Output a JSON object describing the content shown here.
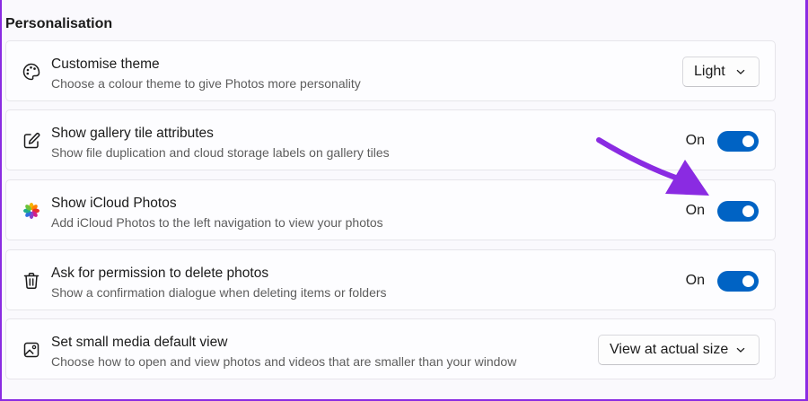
{
  "section": {
    "title": "Personalisation"
  },
  "settings": [
    {
      "title": "Customise theme",
      "desc": "Choose a colour theme to give Photos more personality",
      "icon": "palette-icon",
      "control": "dropdown",
      "value": "Light"
    },
    {
      "title": "Show gallery tile attributes",
      "desc": "Show file duplication and cloud storage labels on gallery tiles",
      "icon": "edit-square-icon",
      "control": "toggle",
      "state_label": "On",
      "on": true
    },
    {
      "title": "Show iCloud Photos",
      "desc": "Add iCloud Photos to the left navigation to view your photos",
      "icon": "icloud-photos-flower-icon",
      "control": "toggle",
      "state_label": "On",
      "on": true
    },
    {
      "title": "Ask for permission to delete photos",
      "desc": "Show a confirmation dialogue when deleting items or folders",
      "icon": "trash-icon",
      "control": "toggle",
      "state_label": "On",
      "on": true
    },
    {
      "title": "Set small media default view",
      "desc": "Choose how to open and view photos and videos that are smaller than your window",
      "icon": "image-icon",
      "control": "dropdown",
      "value": "View at actual size"
    }
  ],
  "colors": {
    "accent": "#0063c4",
    "annotation_arrow": "#8a2be2",
    "frame_border": "#8a2be2"
  }
}
